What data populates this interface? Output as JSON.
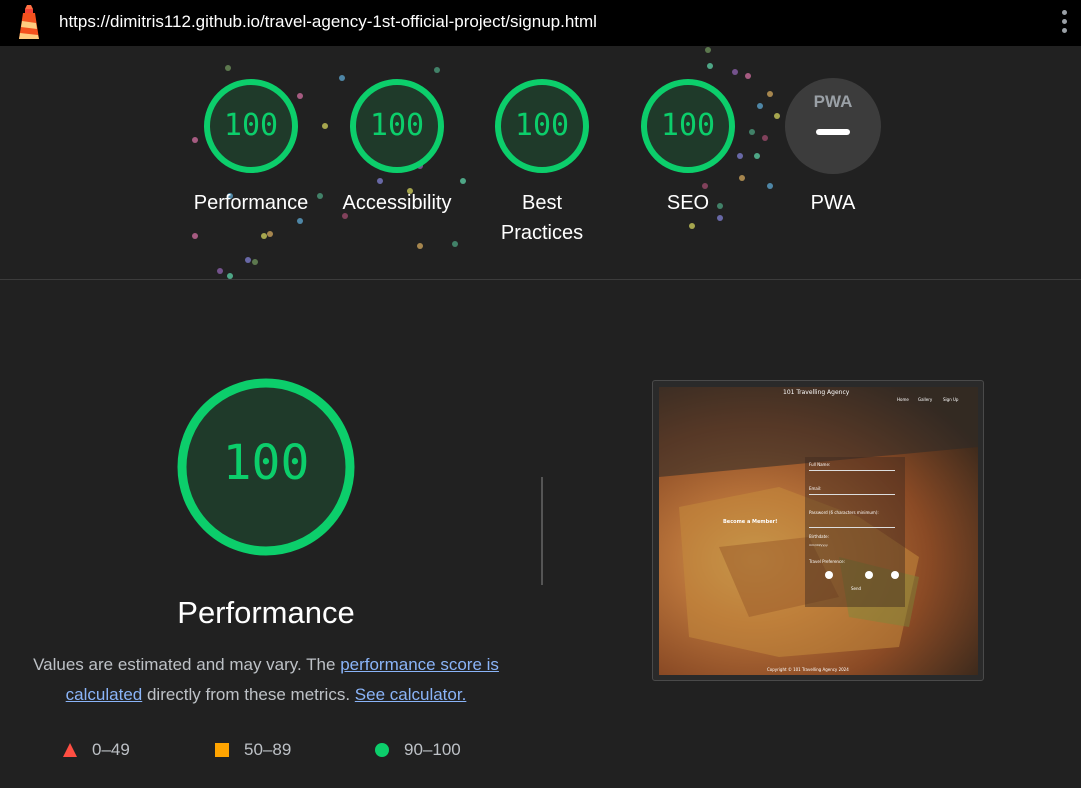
{
  "browser": {
    "url": "https://dimitris112.github.io/travel-agency-1st-official-project/signup.html",
    "logo_icon": "lighthouse-icon",
    "menu_icon": "kebab-menu-icon"
  },
  "colors": {
    "pass": "#0cce6b",
    "average": "#ffa400",
    "fail": "#ff4e42",
    "link": "#8ab4f8",
    "background": "#212121"
  },
  "categories": [
    {
      "label": "Performance",
      "score": "100",
      "fraction": 1.0
    },
    {
      "label": "Accessibility",
      "score": "100",
      "fraction": 1.0
    },
    {
      "label": "Best",
      "label2": "Practices",
      "score": "100",
      "fraction": 1.0
    },
    {
      "label": "SEO",
      "score": "100",
      "fraction": 1.0
    },
    {
      "label": "PWA",
      "badge": "PWA"
    }
  ],
  "performance": {
    "score": "100",
    "fraction": 1.0,
    "title": "Performance",
    "desc_prefix": "Values are estimated and may vary. The ",
    "desc_link1": "performance score is calculated",
    "desc_middle": " directly from these metrics. ",
    "desc_link2": "See calculator."
  },
  "legend": [
    {
      "icon": "triangle-icon",
      "range": "0–49"
    },
    {
      "icon": "square-icon",
      "range": "50–89"
    },
    {
      "icon": "circle-icon",
      "range": "90–100"
    }
  ],
  "screenshot": {
    "site_title": "101 Travelling Agency",
    "nav": [
      "Home",
      "Gallery",
      "Sign Up"
    ],
    "heading": "Become a Member!",
    "fields": [
      "Full Name:",
      "Email:",
      "Password (6 characters minimum):",
      "Birthdate:"
    ],
    "birthdate_placeholder": "mm/dd/yyyy",
    "preference_label": "Travel Preference:",
    "submit": "Send",
    "footer": "Copyright © 101 Travelling Agency 2024"
  }
}
